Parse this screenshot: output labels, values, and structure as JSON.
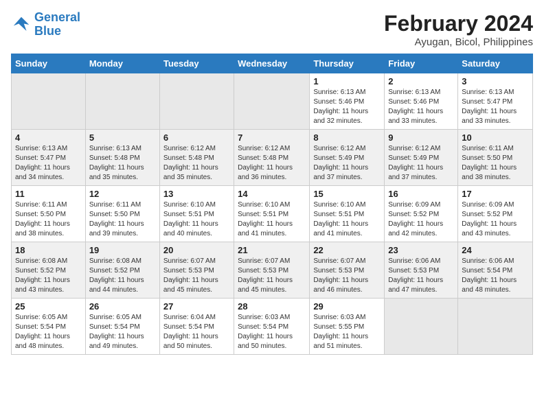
{
  "logo": {
    "line1": "General",
    "line2": "Blue"
  },
  "title": "February 2024",
  "subtitle": "Ayugan, Bicol, Philippines",
  "headers": [
    "Sunday",
    "Monday",
    "Tuesday",
    "Wednesday",
    "Thursday",
    "Friday",
    "Saturday"
  ],
  "weeks": [
    [
      {
        "num": "",
        "info": ""
      },
      {
        "num": "",
        "info": ""
      },
      {
        "num": "",
        "info": ""
      },
      {
        "num": "",
        "info": ""
      },
      {
        "num": "1",
        "info": "Sunrise: 6:13 AM\nSunset: 5:46 PM\nDaylight: 11 hours and 32 minutes."
      },
      {
        "num": "2",
        "info": "Sunrise: 6:13 AM\nSunset: 5:46 PM\nDaylight: 11 hours and 33 minutes."
      },
      {
        "num": "3",
        "info": "Sunrise: 6:13 AM\nSunset: 5:47 PM\nDaylight: 11 hours and 33 minutes."
      }
    ],
    [
      {
        "num": "4",
        "info": "Sunrise: 6:13 AM\nSunset: 5:47 PM\nDaylight: 11 hours and 34 minutes."
      },
      {
        "num": "5",
        "info": "Sunrise: 6:13 AM\nSunset: 5:48 PM\nDaylight: 11 hours and 35 minutes."
      },
      {
        "num": "6",
        "info": "Sunrise: 6:12 AM\nSunset: 5:48 PM\nDaylight: 11 hours and 35 minutes."
      },
      {
        "num": "7",
        "info": "Sunrise: 6:12 AM\nSunset: 5:48 PM\nDaylight: 11 hours and 36 minutes."
      },
      {
        "num": "8",
        "info": "Sunrise: 6:12 AM\nSunset: 5:49 PM\nDaylight: 11 hours and 37 minutes."
      },
      {
        "num": "9",
        "info": "Sunrise: 6:12 AM\nSunset: 5:49 PM\nDaylight: 11 hours and 37 minutes."
      },
      {
        "num": "10",
        "info": "Sunrise: 6:11 AM\nSunset: 5:50 PM\nDaylight: 11 hours and 38 minutes."
      }
    ],
    [
      {
        "num": "11",
        "info": "Sunrise: 6:11 AM\nSunset: 5:50 PM\nDaylight: 11 hours and 38 minutes."
      },
      {
        "num": "12",
        "info": "Sunrise: 6:11 AM\nSunset: 5:50 PM\nDaylight: 11 hours and 39 minutes."
      },
      {
        "num": "13",
        "info": "Sunrise: 6:10 AM\nSunset: 5:51 PM\nDaylight: 11 hours and 40 minutes."
      },
      {
        "num": "14",
        "info": "Sunrise: 6:10 AM\nSunset: 5:51 PM\nDaylight: 11 hours and 41 minutes."
      },
      {
        "num": "15",
        "info": "Sunrise: 6:10 AM\nSunset: 5:51 PM\nDaylight: 11 hours and 41 minutes."
      },
      {
        "num": "16",
        "info": "Sunrise: 6:09 AM\nSunset: 5:52 PM\nDaylight: 11 hours and 42 minutes."
      },
      {
        "num": "17",
        "info": "Sunrise: 6:09 AM\nSunset: 5:52 PM\nDaylight: 11 hours and 43 minutes."
      }
    ],
    [
      {
        "num": "18",
        "info": "Sunrise: 6:08 AM\nSunset: 5:52 PM\nDaylight: 11 hours and 43 minutes."
      },
      {
        "num": "19",
        "info": "Sunrise: 6:08 AM\nSunset: 5:52 PM\nDaylight: 11 hours and 44 minutes."
      },
      {
        "num": "20",
        "info": "Sunrise: 6:07 AM\nSunset: 5:53 PM\nDaylight: 11 hours and 45 minutes."
      },
      {
        "num": "21",
        "info": "Sunrise: 6:07 AM\nSunset: 5:53 PM\nDaylight: 11 hours and 45 minutes."
      },
      {
        "num": "22",
        "info": "Sunrise: 6:07 AM\nSunset: 5:53 PM\nDaylight: 11 hours and 46 minutes."
      },
      {
        "num": "23",
        "info": "Sunrise: 6:06 AM\nSunset: 5:53 PM\nDaylight: 11 hours and 47 minutes."
      },
      {
        "num": "24",
        "info": "Sunrise: 6:06 AM\nSunset: 5:54 PM\nDaylight: 11 hours and 48 minutes."
      }
    ],
    [
      {
        "num": "25",
        "info": "Sunrise: 6:05 AM\nSunset: 5:54 PM\nDaylight: 11 hours and 48 minutes."
      },
      {
        "num": "26",
        "info": "Sunrise: 6:05 AM\nSunset: 5:54 PM\nDaylight: 11 hours and 49 minutes."
      },
      {
        "num": "27",
        "info": "Sunrise: 6:04 AM\nSunset: 5:54 PM\nDaylight: 11 hours and 50 minutes."
      },
      {
        "num": "28",
        "info": "Sunrise: 6:03 AM\nSunset: 5:54 PM\nDaylight: 11 hours and 50 minutes."
      },
      {
        "num": "29",
        "info": "Sunrise: 6:03 AM\nSunset: 5:55 PM\nDaylight: 11 hours and 51 minutes."
      },
      {
        "num": "",
        "info": ""
      },
      {
        "num": "",
        "info": ""
      }
    ]
  ]
}
